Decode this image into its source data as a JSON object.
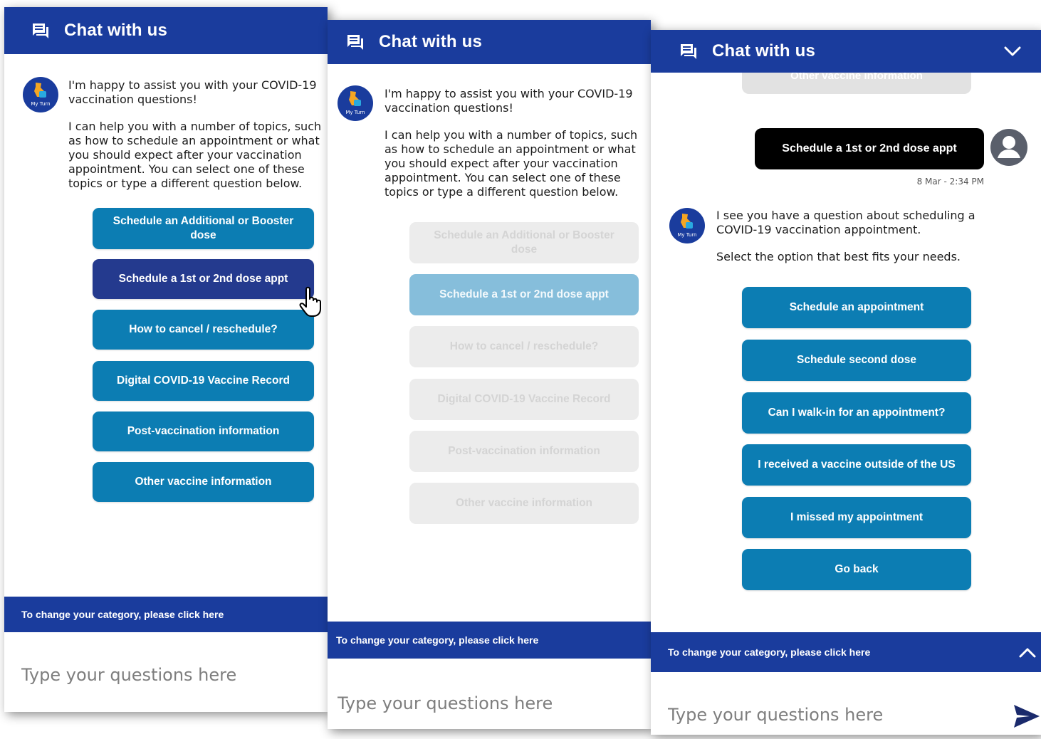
{
  "header": {
    "title": "Chat with us"
  },
  "bot": {
    "brand": "My Turn",
    "greeting": "I'm happy to assist you with your COVID-19 vaccination questions!",
    "intro": "I can help you with a number of topics, such as how to schedule an appointment or what you should expect after your vaccination appointment. You can select one of these topics or type a different question below."
  },
  "topics": [
    "Schedule an Additional or Booster dose",
    "Schedule a 1st or 2nd dose appt",
    "How to cancel / reschedule?",
    "Digital COVID-19 Vaccine Record",
    "Post-vaccination information",
    "Other vaccine information"
  ],
  "category_bar": {
    "label": "To change your category, please click here"
  },
  "input": {
    "placeholder": "Type your questions here"
  },
  "conversation": {
    "clipped_option": "Other vaccine information",
    "user_message": "Schedule a 1st or 2nd dose appt",
    "timestamp": "8 Mar - 2:34 PM",
    "bot_reply_1": "I see you have a question about scheduling a COVID-19 vaccination appointment.",
    "bot_reply_2": "Select the option that best fits your needs.",
    "options": [
      "Schedule an appointment",
      "Schedule second dose",
      "Can I walk-in for an appointment?",
      "I received a vaccine outside of the US",
      "I missed my appointment",
      "Go back"
    ]
  },
  "colors": {
    "header_blue": "#1a3c9d",
    "button_blue": "#0c7db3",
    "selected_button": "#243a8e",
    "arrow_orange": "#f07c1e"
  },
  "icons": [
    "chat-icon",
    "chevron-down-icon",
    "chevron-up-icon",
    "send-icon",
    "user-avatar-icon",
    "hand-cursor-icon",
    "arrow-icon"
  ]
}
